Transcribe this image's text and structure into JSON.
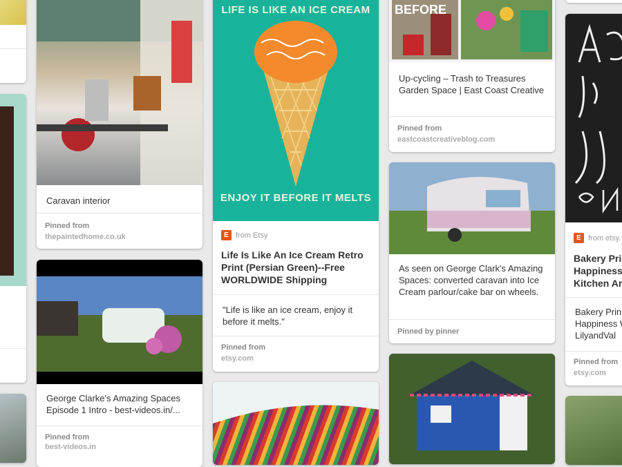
{
  "pins": {
    "left_partial": {
      "desc_tail": ""
    },
    "caravan": {
      "desc": "Caravan interior",
      "pinned_label": "Pinned from",
      "pinned_source": "thepaintedhome.co.uk"
    },
    "george": {
      "desc": "George Clarke's Amazing Spaces Episode 1 Intro - best-videos.in/...",
      "pinned_label": "Pinned from",
      "pinned_source": "best-videos.in"
    },
    "icecream": {
      "poster_top": "LIFE IS LIKE AN ICE CREAM",
      "poster_bottom": "ENJOY IT BEFORE IT MELTS",
      "from": "from Etsy",
      "title": "Life Is Like An Ice Cream Retro Print (Persian Green)--Free WORLDWIDE Shipping",
      "desc": "\"Life is like an ice cream, enjoy it before it melts.\"",
      "pinned_label": "Pinned from",
      "pinned_source": "etsy.com",
      "bg_color": "#19b39b"
    },
    "upcycling": {
      "before_label": "BEFORE",
      "desc": "Up-cycling – Trash to Treasures Garden Space | East Coast Creative",
      "pinned_label": "Pinned from",
      "pinned_source": "eastcoastcreativeblog.com"
    },
    "caravan_ice": {
      "desc": "As seen on George Clark's Amazing Spaces: converted caravan into Ice Cream parlour/cake bar on wheels.",
      "pinned_label": "Pinned by pinner"
    },
    "bakery": {
      "poster_text": "A is h ic ON",
      "from": "from etsy.",
      "title": "Bakery Pri Happiness Kitchen Ar",
      "desc": "Bakery Prin Happiness W LilyandVal",
      "pinned_label": "Pinned from",
      "pinned_source": "etsy.com"
    }
  }
}
